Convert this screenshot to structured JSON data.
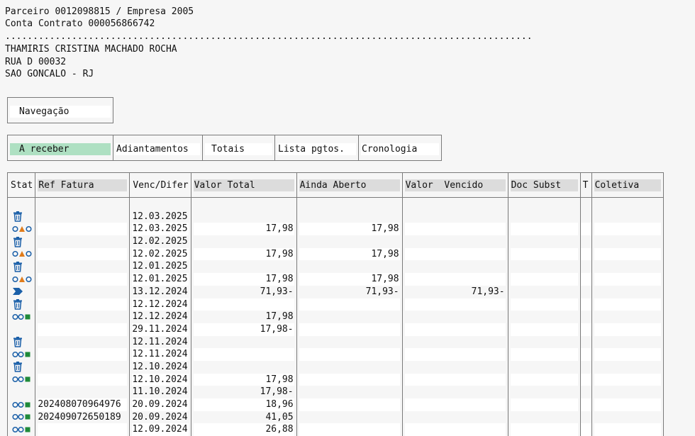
{
  "header": {
    "line1": "Parceiro 0012098815 / Empresa 2005",
    "line2": "Conta Contrato 000056866742",
    "dots": "...............................................................................................",
    "name": "THAMIRIS CRISTINA MACHADO ROCHA",
    "street": "RUA D 00032",
    "city": "SAO GONCALO - RJ"
  },
  "nav_button": "Navegação",
  "tabs": [
    "A receber",
    "Adiantamentos",
    "Totais",
    "Lista pgtos.",
    "Cronologia"
  ],
  "active_tab": "A receber",
  "columns": [
    "Stat",
    "Ref Fatura",
    "Venc/Difer",
    "Valor Total",
    "Ainda Aberto",
    "Valor  Vencido",
    "Doc Subst",
    "T",
    "Coletiva"
  ],
  "rows": [
    {
      "stat": "trash-icon",
      "ref": "",
      "venc": "12.03.2025",
      "total": "",
      "aberto": "",
      "vencido": ""
    },
    {
      "stat": "circle-triangle-circle-icon",
      "ref": "",
      "venc": "12.03.2025",
      "total": "17,98",
      "aberto": "17,98",
      "vencido": ""
    },
    {
      "stat": "trash-icon",
      "ref": "",
      "venc": "12.02.2025",
      "total": "",
      "aberto": "",
      "vencido": ""
    },
    {
      "stat": "circle-triangle-circle-icon",
      "ref": "",
      "venc": "12.02.2025",
      "total": "17,98",
      "aberto": "17,98",
      "vencido": ""
    },
    {
      "stat": "trash-icon",
      "ref": "",
      "venc": "12.01.2025",
      "total": "",
      "aberto": "",
      "vencido": ""
    },
    {
      "stat": "circle-triangle-circle-icon",
      "ref": "",
      "venc": "12.01.2025",
      "total": "17,98",
      "aberto": "17,98",
      "vencido": ""
    },
    {
      "stat": "arrow-chevron-icon",
      "ref": "",
      "venc": "13.12.2024",
      "total": "71,93-",
      "aberto": "71,93-",
      "vencido": "71,93-"
    },
    {
      "stat": "trash-icon",
      "ref": "",
      "venc": "12.12.2024",
      "total": "",
      "aberto": "",
      "vencido": ""
    },
    {
      "stat": "circle-circle-square-icon",
      "ref": "",
      "venc": "12.12.2024",
      "total": "17,98",
      "aberto": "",
      "vencido": ""
    },
    {
      "stat": "",
      "ref": "",
      "venc": "29.11.2024",
      "total": "17,98-",
      "aberto": "",
      "vencido": ""
    },
    {
      "stat": "trash-icon",
      "ref": "",
      "venc": "12.11.2024",
      "total": "",
      "aberto": "",
      "vencido": ""
    },
    {
      "stat": "circle-circle-square-icon",
      "ref": "",
      "venc": "12.11.2024",
      "total": "",
      "aberto": "",
      "vencido": ""
    },
    {
      "stat": "trash-icon",
      "ref": "",
      "venc": "12.10.2024",
      "total": "",
      "aberto": "",
      "vencido": ""
    },
    {
      "stat": "circle-circle-square-icon",
      "ref": "",
      "venc": "12.10.2024",
      "total": "17,98",
      "aberto": "",
      "vencido": ""
    },
    {
      "stat": "",
      "ref": "",
      "venc": "11.10.2024",
      "total": "17,98-",
      "aberto": "",
      "vencido": ""
    },
    {
      "stat": "circle-circle-square-icon",
      "ref": "202408070964976",
      "venc": "20.09.2024",
      "total": "18,96",
      "aberto": "",
      "vencido": ""
    },
    {
      "stat": "circle-circle-square-icon",
      "ref": "202409072650189",
      "venc": "20.09.2024",
      "total": "41,05",
      "aberto": "",
      "vencido": ""
    },
    {
      "stat": "circle-circle-square-icon",
      "ref": "",
      "venc": "12.09.2024",
      "total": "26,88",
      "aberto": "",
      "vencido": ""
    }
  ],
  "colors": {
    "active_tab": "#aee0c2",
    "icon_blue": "#1a5fa8",
    "triangle": "#e07b1a",
    "square": "#1f8a3a"
  }
}
